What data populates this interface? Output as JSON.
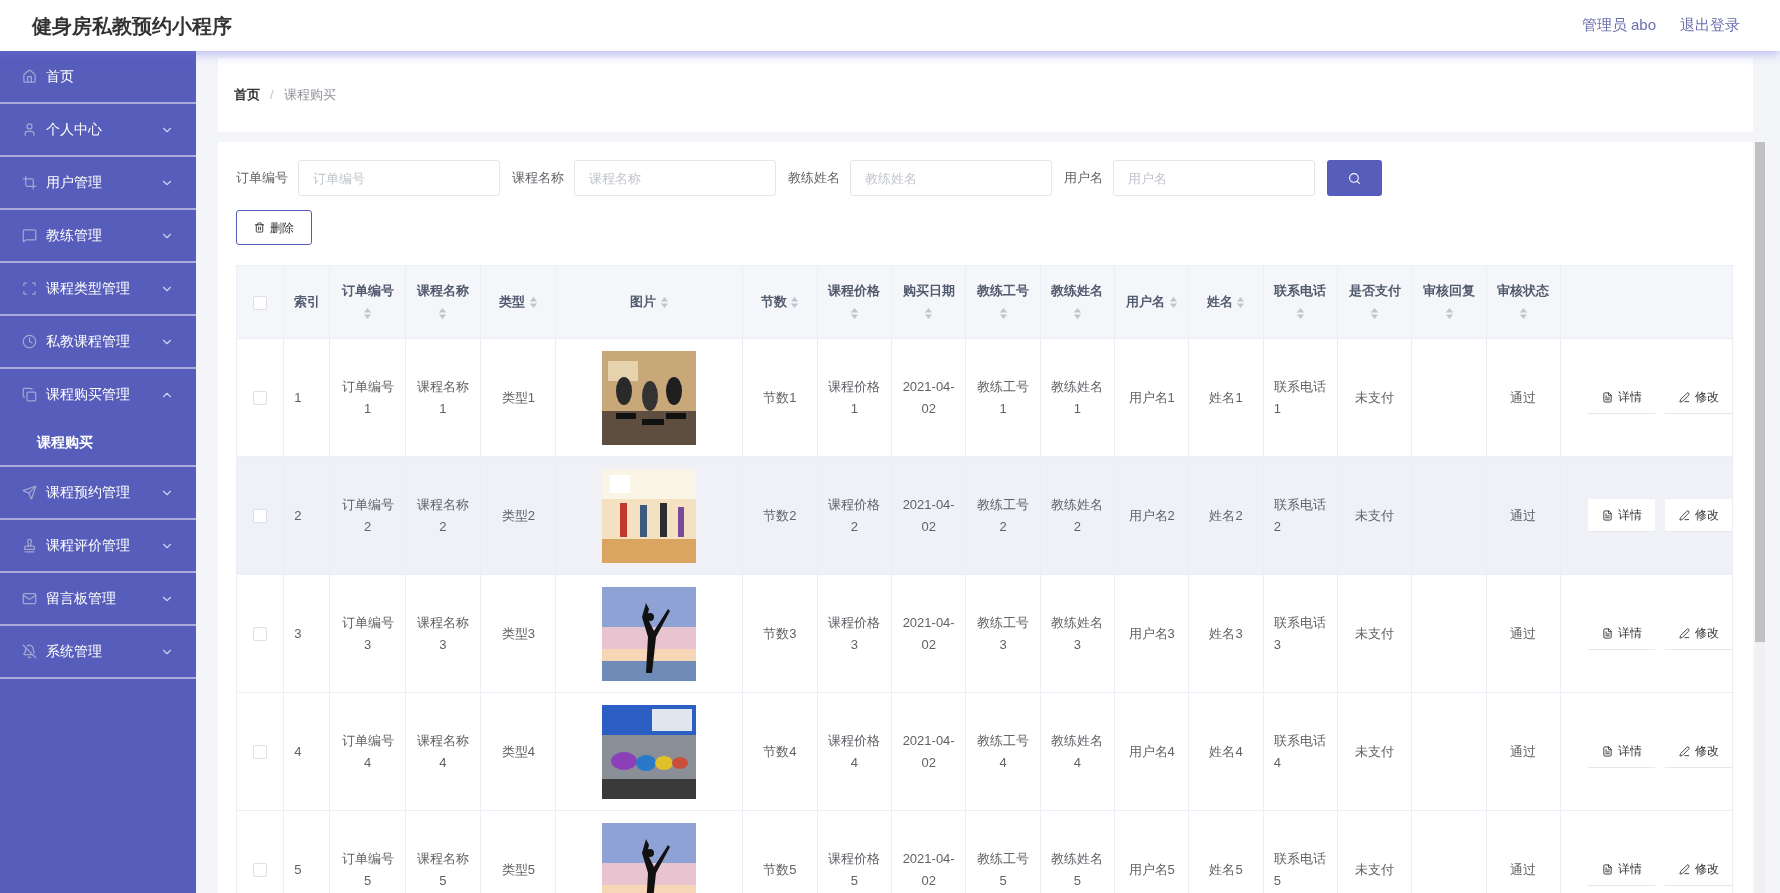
{
  "header": {
    "title": "健身房私教预约小程序",
    "user": "管理员 abo",
    "logout": "退出登录"
  },
  "sidebar": {
    "items": [
      {
        "label": "首页"
      },
      {
        "label": "个人中心",
        "expanded": false
      },
      {
        "label": "用户管理",
        "expanded": false
      },
      {
        "label": "教练管理",
        "expanded": false
      },
      {
        "label": "课程类型管理",
        "expanded": false
      },
      {
        "label": "私教课程管理",
        "expanded": false
      },
      {
        "label": "课程购买管理",
        "expanded": true,
        "children": [
          {
            "label": "课程购买",
            "selected": true
          }
        ]
      },
      {
        "label": "课程预约管理",
        "expanded": false
      },
      {
        "label": "课程评价管理",
        "expanded": false
      },
      {
        "label": "留言板管理",
        "expanded": false
      },
      {
        "label": "系统管理",
        "expanded": false
      }
    ]
  },
  "breadcrumb": {
    "items": [
      "首页",
      "课程购买"
    ],
    "separator": "/"
  },
  "filters": [
    {
      "label": "订单编号",
      "placeholder": "订单编号"
    },
    {
      "label": "课程名称",
      "placeholder": "课程名称"
    },
    {
      "label": "教练姓名",
      "placeholder": "教练姓名"
    },
    {
      "label": "用户名",
      "placeholder": "用户名"
    }
  ],
  "delete_button": "删除",
  "table": {
    "select_all": {
      "checked": false
    },
    "columns": [
      {
        "label": "索引",
        "sortable": false
      },
      {
        "label": "订单编号",
        "sortable": true
      },
      {
        "label": "课程名称",
        "sortable": true
      },
      {
        "label": "类型",
        "sortable": true
      },
      {
        "label": "图片",
        "sortable": true
      },
      {
        "label": "节数",
        "sortable": true
      },
      {
        "label": "课程价格",
        "sortable": true
      },
      {
        "label": "购买日期",
        "sortable": true
      },
      {
        "label": "教练工号",
        "sortable": true
      },
      {
        "label": "教练姓名",
        "sortable": true
      },
      {
        "label": "用户名",
        "sortable": true
      },
      {
        "label": "姓名",
        "sortable": true
      },
      {
        "label": "联系电话",
        "sortable": true
      },
      {
        "label": "是否支付",
        "sortable": true
      },
      {
        "label": "审核回复",
        "sortable": true
      },
      {
        "label": "审核状态",
        "sortable": true
      }
    ],
    "rows": [
      {
        "checked": false,
        "hovered": false,
        "cells": [
          "1",
          "订单编号1",
          "课程名称1",
          "类型1",
          null,
          "节数1",
          "课程价格1",
          "2021-04-02",
          "教练工号1",
          "教练姓名1",
          "用户名1",
          "姓名1",
          "联系电话1",
          "未支付",
          null,
          "通过"
        ],
        "actions": [
          "详情",
          "修改"
        ]
      },
      {
        "checked": false,
        "hovered": true,
        "cells": [
          "2",
          "订单编号2",
          "课程名称2",
          "类型2",
          null,
          "节数2",
          "课程价格2",
          "2021-04-02",
          "教练工号2",
          "教练姓名2",
          "用户名2",
          "姓名2",
          "联系电话2",
          "未支付",
          null,
          "通过"
        ],
        "actions": [
          "详情",
          "修改"
        ]
      },
      {
        "checked": false,
        "hovered": false,
        "cells": [
          "3",
          "订单编号3",
          "课程名称3",
          "类型3",
          null,
          "节数3",
          "课程价格3",
          "2021-04-02",
          "教练工号3",
          "教练姓名3",
          "用户名3",
          "姓名3",
          "联系电话3",
          "未支付",
          null,
          "通过"
        ],
        "actions": [
          "详情",
          "修改"
        ]
      },
      {
        "checked": false,
        "hovered": false,
        "cells": [
          "4",
          "订单编号4",
          "课程名称4",
          "类型4",
          null,
          "节数4",
          "课程价格4",
          "2021-04-02",
          "教练工号4",
          "教练姓名4",
          "用户名4",
          "姓名4",
          "联系电话4",
          "未支付",
          null,
          "通过"
        ],
        "actions": [
          "详情",
          "修改"
        ]
      },
      {
        "checked": false,
        "hovered": false,
        "cells": [
          "5",
          "订单编号5",
          "课程名称5",
          "类型5",
          null,
          "节数5",
          "课程价格5",
          "2021-04-02",
          "教练工号5",
          "教练姓名5",
          "用户名5",
          "姓名5",
          "联系电话5",
          "未支付",
          null,
          "通过"
        ],
        "actions": [
          "详情",
          "修改"
        ]
      }
    ]
  }
}
